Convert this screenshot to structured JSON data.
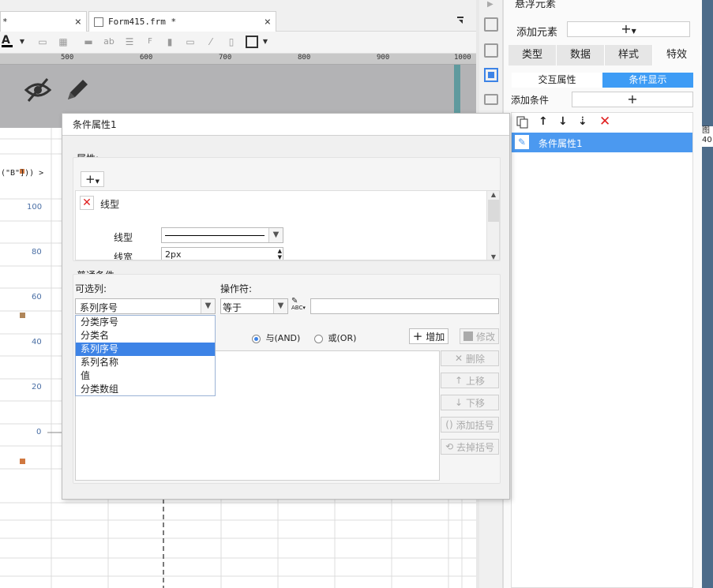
{
  "tabs": [
    {
      "label": "*",
      "close": "×"
    },
    {
      "label": "Form415.frm *",
      "close": "×"
    }
  ],
  "ruler_ticks": [
    "500",
    "600",
    "700",
    "800",
    "900",
    "1000"
  ],
  "y_axis_labels": [
    "100",
    "80",
    "60",
    "40",
    "20",
    "0"
  ],
  "formula_snippet": "(\"B\"])) >",
  "right_panel": {
    "header": "悬浮元素",
    "add_element_label": "添加元素",
    "add_element_btn": "+",
    "tabs": [
      "类型",
      "数据",
      "样式",
      "特效"
    ],
    "subtabs": [
      "交互属性",
      "条件显示"
    ],
    "add_condition_label": "添加条件",
    "add_condition_btn": "+",
    "condition_items": [
      "条件属性1"
    ],
    "edge_text": [
      "图",
      "40"
    ]
  },
  "dialog": {
    "title": "条件属性1",
    "attr_section": "属性:",
    "attr_add_btn": "+",
    "attr_item": "线型",
    "line_type_label": "线型",
    "line_width_label": "线宽",
    "line_width_value": "2px",
    "common_section": "普通条件",
    "optional_col_label": "可选列:",
    "optional_col_value": "系列序号",
    "operator_label": "操作符:",
    "operator_value": "等于",
    "value_input": "",
    "dropdown_options": [
      "分类序号",
      "分类名",
      "系列序号",
      "系列名称",
      "值",
      "分类数组"
    ],
    "dropdown_selected_index": 2,
    "and_label": "与(AND)",
    "or_label": "或(OR)",
    "logic_selected": "AND",
    "add_btn": "增加",
    "modify_btn": "修改",
    "delete_btn": "删除",
    "up_btn": "上移",
    "down_btn": "下移",
    "add_paren_btn": "添加括号",
    "remove_paren_btn": "去掉括号"
  },
  "colors": {
    "accent": "#3d83e6",
    "delete_red": "#e02020",
    "canvas_gray": "#b3b3b5"
  }
}
